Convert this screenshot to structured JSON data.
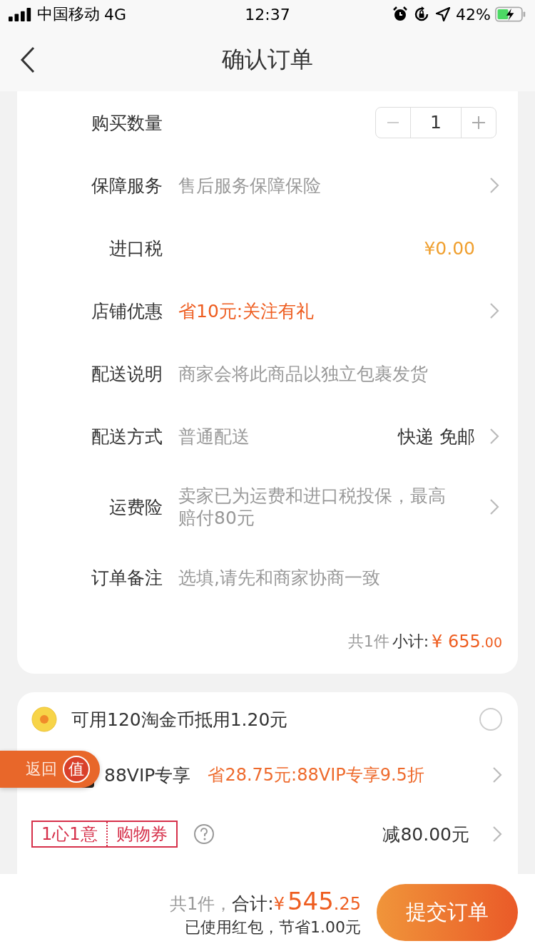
{
  "status_bar": {
    "carrier": "中国移动",
    "network": "4G",
    "time": "12:37",
    "battery": "42%"
  },
  "nav": {
    "title": "确认订单"
  },
  "order_rows": [
    {
      "kind": "stepper",
      "label": "购买数量",
      "value": "1"
    },
    {
      "kind": "link",
      "label": "保障服务",
      "value": "售后服务保障保险"
    },
    {
      "kind": "price",
      "label": "进口税",
      "amount": "¥0.00"
    },
    {
      "kind": "offer",
      "label": "店铺优惠",
      "value": "省10元:关注有礼"
    },
    {
      "kind": "text",
      "label": "配送说明",
      "value": "商家会将此商品以独立包裹发货"
    },
    {
      "kind": "shipping",
      "label": "配送方式",
      "value": "普通配送",
      "option": "快递 免邮"
    },
    {
      "kind": "link",
      "label": "运费险",
      "value": "卖家已为运费和进口税投保，最高赔付80元"
    },
    {
      "kind": "field",
      "label": "订单备注",
      "placeholder": "选填,请先和商家协商一致"
    }
  ],
  "subtotal": {
    "count": "共1件",
    "label": "小计:",
    "currency": "¥",
    "amount": "655",
    "decimals": ".00"
  },
  "discounts": [
    {
      "kind": "coin",
      "text": "可用120淘金币抵用1.20元",
      "checked": false
    },
    {
      "kind": "vip",
      "title": "88VIP专享",
      "offer": "省28.75元:88VIP专享9.5折"
    },
    {
      "kind": "coupon",
      "tag_left": "1心1意",
      "tag_right": "购物券",
      "value": "减80.00元"
    }
  ],
  "float_button": {
    "label": "返回",
    "badge": "值"
  },
  "footer": {
    "count": "共1件，",
    "label": "合计:",
    "currency": "¥",
    "amount": "545",
    "decimals": ".25",
    "note": "已使用红包，节省1.00元",
    "submit": "提交订单"
  }
}
